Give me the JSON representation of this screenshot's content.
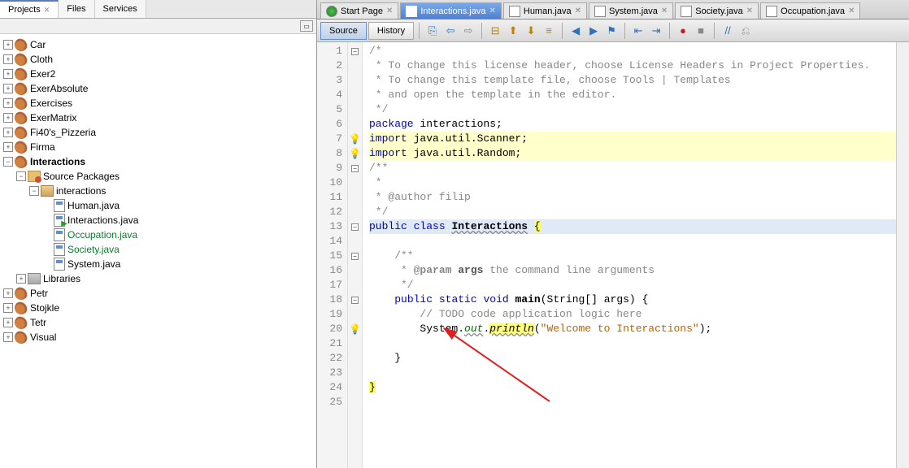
{
  "leftTabs": {
    "projects": "Projects",
    "files": "Files",
    "services": "Services"
  },
  "tree": {
    "car": "Car",
    "cloth": "Cloth",
    "exer2": "Exer2",
    "exerAbsolute": "ExerAbsolute",
    "exercises": "Exercises",
    "exerMatrix": "ExerMatrix",
    "pizzeria": "Fi40's_Pizzeria",
    "firma": "Firma",
    "interactions": "Interactions",
    "sourcePackages": "Source Packages",
    "pkgInteractions": "interactions",
    "humanJava": "Human.java",
    "interactionsJava": "Interactions.java",
    "occupationJava": "Occupation.java",
    "societyJava": "Society.java",
    "systemJava": "System.java",
    "libraries": "Libraries",
    "petr": "Petr",
    "stojkle": "Stojkle",
    "tetr": "Tetr",
    "visual": "Visual"
  },
  "editorTabs": {
    "startPage": "Start Page",
    "interactions": "Interactions.java",
    "human": "Human.java",
    "system": "System.java",
    "society": "Society.java",
    "occupation": "Occupation.java"
  },
  "toolbar": {
    "source": "Source",
    "history": "History"
  },
  "lineNumbers": [
    "1",
    "2",
    "3",
    "4",
    "5",
    "6",
    "7",
    "8",
    "9",
    "10",
    "11",
    "12",
    "13",
    "14",
    "15",
    "16",
    "17",
    "18",
    "19",
    "20",
    "21",
    "22",
    "23",
    "24",
    "25"
  ],
  "code": {
    "l1": "/*",
    "l2": " * To change this license header, choose License Headers in Project Properties.",
    "l3": " * To change this template file, choose Tools | Templates",
    "l4": " * and open the template in the editor.",
    "l5": " */",
    "l6a": "package",
    "l6b": " interactions;",
    "l7a": "import",
    "l7b": " java.util.Scanner;",
    "l8a": "import",
    "l8b": " java.util.Random;",
    "l9": "/**",
    "l10": " *",
    "l11": " * @author filip",
    "l12": " */",
    "l13a": "public",
    "l13b": "class",
    "l13c": "Interactions",
    "l13d": "{",
    "l15": "    /**",
    "l16a": "     * ",
    "l16b": "@param",
    "l16c": "args",
    "l16d": " the command line arguments",
    "l17": "     */",
    "l18a": "public",
    "l18b": "static",
    "l18c": "void",
    "l18d": "main",
    "l18e": "(String[] args) {",
    "l19": "        // TODO code application logic here",
    "l20a": "        System.",
    "l20b": "out",
    "l20c": ".",
    "l20d": "println",
    "l20e": "(",
    "l20f": "\"Welcome to Interactions\"",
    "l20g": ");",
    "l22": "    }",
    "l24": "}"
  }
}
